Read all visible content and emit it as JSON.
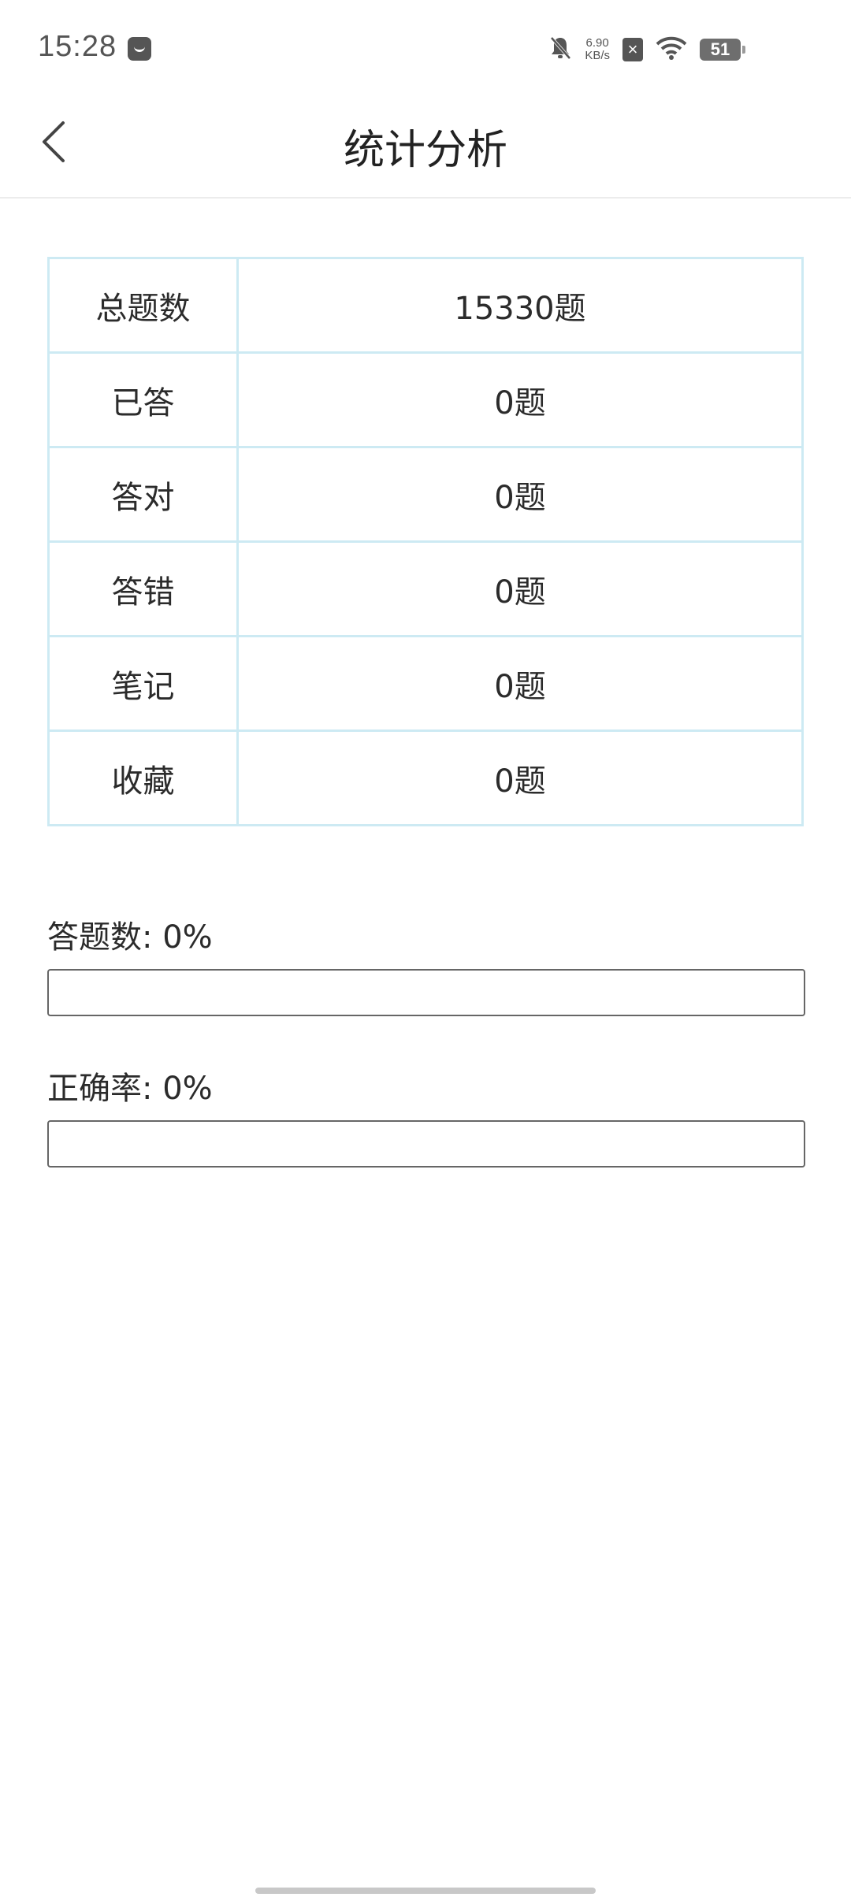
{
  "status_bar": {
    "time": "15:28",
    "net_speed_value": "6.90",
    "net_speed_unit": "KB/s",
    "battery": "51",
    "icons": [
      "app-notification-icon",
      "mute-bell-icon",
      "sim-off-icon",
      "wifi-icon",
      "battery-icon"
    ]
  },
  "header": {
    "title": "统计分析",
    "back_icon": "chevron-left-icon"
  },
  "stats": {
    "rows": [
      {
        "label": "总题数",
        "value": "15330题"
      },
      {
        "label": "已答",
        "value": "0题"
      },
      {
        "label": "答对",
        "value": "0题"
      },
      {
        "label": "答错",
        "value": "0题"
      },
      {
        "label": "笔记",
        "value": "0题"
      },
      {
        "label": "收藏",
        "value": "0题"
      }
    ]
  },
  "progress": {
    "answered": {
      "label": "答题数: 0%",
      "percent": 0
    },
    "accuracy": {
      "label": "正确率: 0%",
      "percent": 0
    }
  },
  "colors": {
    "table_border": "#cdeaf3",
    "progress_border": "#666666",
    "divider": "#ececec"
  }
}
